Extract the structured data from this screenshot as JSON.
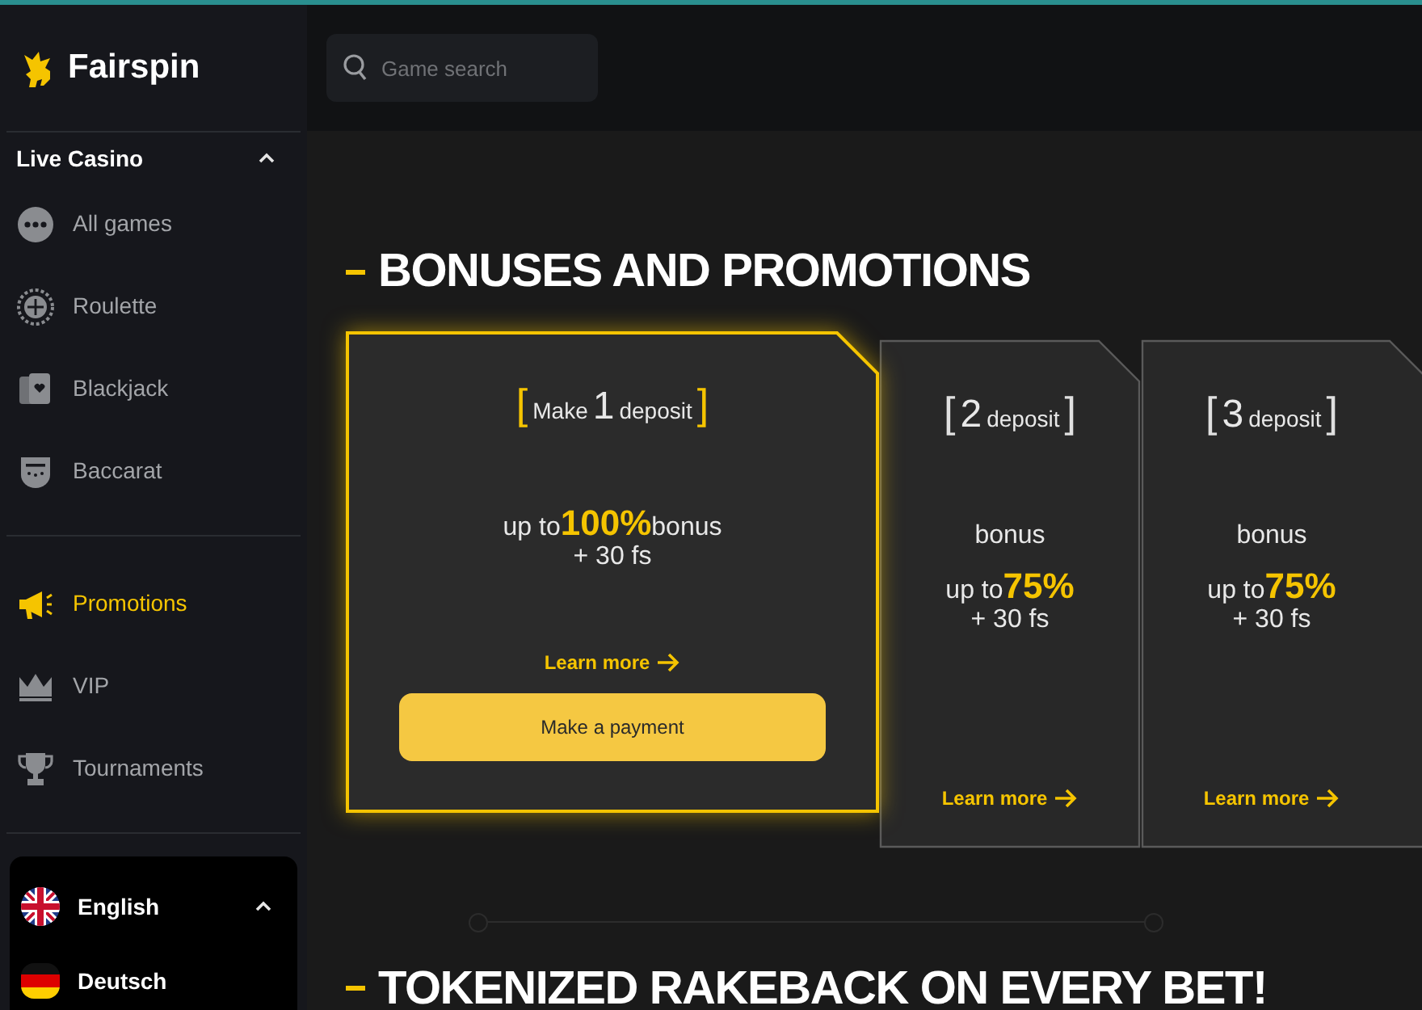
{
  "brand": {
    "name": "Fairspin"
  },
  "sidebar": {
    "sections": [
      {
        "title": "Live Casino",
        "expanded": true,
        "items": [
          {
            "label": "All games",
            "kind": "dots",
            "selected": false
          },
          {
            "label": "Roulette",
            "kind": "roulette",
            "selected": false
          },
          {
            "label": "Blackjack",
            "kind": "cards",
            "selected": false
          },
          {
            "label": "Baccarat",
            "kind": "baccarat",
            "selected": false
          }
        ]
      },
      {
        "items": [
          {
            "label": "Promotions",
            "kind": "megaphone",
            "selected": true
          },
          {
            "label": "VIP",
            "kind": "crown",
            "selected": false
          },
          {
            "label": "Tournaments",
            "kind": "trophy",
            "selected": false
          }
        ]
      }
    ]
  },
  "languages": {
    "expanded": true,
    "items": [
      {
        "label": "English",
        "kind": "uk"
      },
      {
        "label": "Deutsch",
        "kind": "de"
      }
    ]
  },
  "search": {
    "placeholder": "Game search"
  },
  "sections": [
    {
      "title": "BONUSES AND PROMOTIONS"
    },
    {
      "title": "TOKENIZED RAKEBACK ON EVERY BET!"
    }
  ],
  "cards": [
    {
      "selected": true,
      "title": {
        "open": "[",
        "prefix": "Make",
        "number": "1",
        "word": "deposit",
        "close": "]"
      },
      "lines": [
        [
          {
            "text": "up to",
            "accent": false
          },
          {
            "text": "100%",
            "accent": true
          },
          {
            "text": "bonus",
            "accent": false
          }
        ],
        [
          {
            "text": "+ 30 fs",
            "accent": false
          }
        ]
      ],
      "link": "Learn more",
      "button": "Make a payment"
    },
    {
      "selected": false,
      "title": {
        "open": "[",
        "number": "2",
        "word": "deposit",
        "close": "]"
      },
      "lines": [
        [
          {
            "text": "bonus",
            "accent": false
          }
        ],
        [
          {
            "text": "up to",
            "accent": false
          },
          {
            "text": "75%",
            "accent": true
          }
        ],
        [
          {
            "text": "+ 30 fs",
            "accent": false
          }
        ]
      ],
      "link": "Learn more"
    },
    {
      "selected": false,
      "title": {
        "open": "[",
        "number": "3",
        "word": "deposit",
        "close": "]"
      },
      "lines": [
        [
          {
            "text": "bonus",
            "accent": false
          }
        ],
        [
          {
            "text": "up to",
            "accent": false
          },
          {
            "text": "75%",
            "accent": true
          }
        ],
        [
          {
            "text": "+ 30 fs",
            "accent": false
          }
        ]
      ],
      "link": "Learn more"
    }
  ]
}
